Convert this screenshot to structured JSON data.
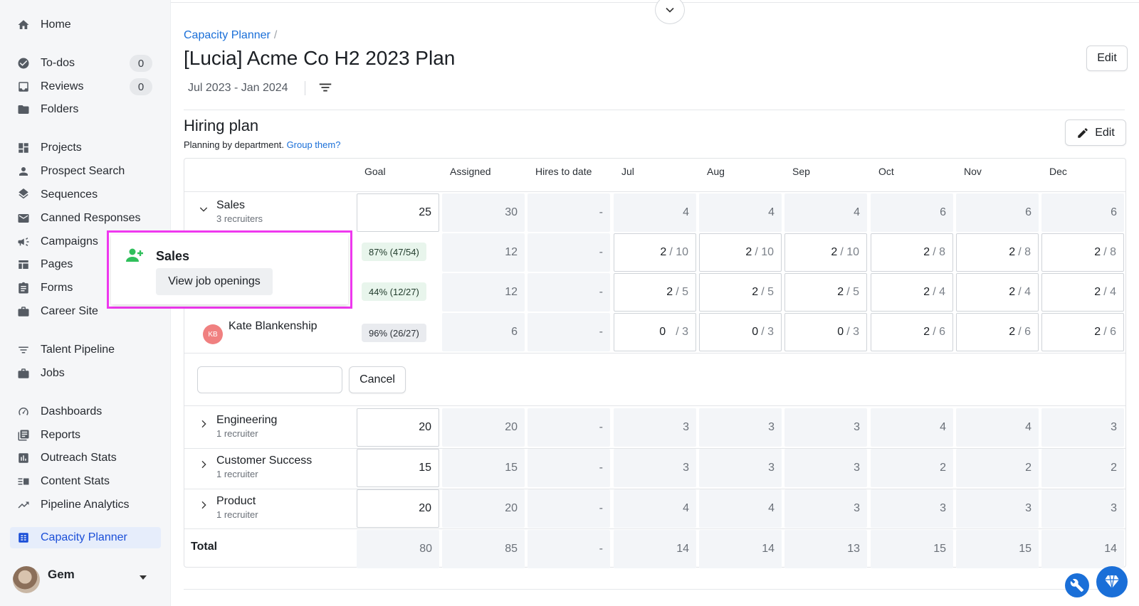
{
  "sidebar": {
    "items": [
      {
        "label": "Home",
        "icon": "home-icon"
      },
      {
        "label": "To-dos",
        "icon": "check-circle-icon",
        "count": "0"
      },
      {
        "label": "Reviews",
        "icon": "inbox-icon",
        "count": "0"
      },
      {
        "label": "Folders",
        "icon": "folder-icon"
      },
      {
        "label": "Projects",
        "icon": "dashboard-grid-icon"
      },
      {
        "label": "Prospect Search",
        "icon": "person-icon"
      },
      {
        "label": "Sequences",
        "icon": "layers-icon"
      },
      {
        "label": "Canned Responses",
        "icon": "envelope-icon"
      },
      {
        "label": "Campaigns",
        "icon": "megaphone-icon"
      },
      {
        "label": "Pages",
        "icon": "web-page-icon"
      },
      {
        "label": "Forms",
        "icon": "clipboard-icon"
      },
      {
        "label": "Career Site",
        "icon": "briefcase-icon"
      },
      {
        "label": "Talent Pipeline",
        "icon": "filter-lines-icon"
      },
      {
        "label": "Jobs",
        "icon": "briefcase-icon"
      },
      {
        "label": "Dashboards",
        "icon": "gauge-icon"
      },
      {
        "label": "Reports",
        "icon": "report-icon"
      },
      {
        "label": "Outreach Stats",
        "icon": "bar-chart-icon"
      },
      {
        "label": "Content Stats",
        "icon": "content-stats-icon"
      },
      {
        "label": "Pipeline Analytics",
        "icon": "trend-line-icon"
      },
      {
        "label": "Capacity Planner",
        "icon": "calendar-grid-icon"
      }
    ],
    "user": {
      "name": "Gem"
    }
  },
  "header": {
    "breadcrumb": "Capacity Planner",
    "breadcrumb_sep": "/",
    "title": "[Lucia] Acme Co H2 2023 Plan",
    "edit_label": "Edit",
    "date_range": "Jul 2023 - Jan 2024"
  },
  "section": {
    "title": "Hiring plan",
    "subtitle": "Planning by department.",
    "link": "Group them?",
    "edit_label": "Edit"
  },
  "table": {
    "headers": [
      "Goal",
      "Assigned",
      "Hires to date",
      "Jul",
      "Aug",
      "Sep",
      "Oct",
      "Nov",
      "Dec"
    ],
    "sales": {
      "name": "Sales",
      "sub": "3 recruiters",
      "goal": "25",
      "assigned": "30",
      "hires": "-",
      "months": [
        "4",
        "4",
        "4",
        "6",
        "6",
        "6"
      ]
    },
    "recruiters": [
      {
        "pill": "87% (47/54)",
        "assigned": "12",
        "hires": "-",
        "months": [
          [
            "2",
            "/ 10"
          ],
          [
            "2",
            "/ 10"
          ],
          [
            "2",
            "/ 10"
          ],
          [
            "2",
            "/ 8"
          ],
          [
            "2",
            "/ 8"
          ],
          [
            "2",
            "/ 8"
          ]
        ]
      },
      {
        "pill": "44% (12/27)",
        "assigned": "12",
        "hires": "-",
        "months": [
          [
            "2",
            "/ 5"
          ],
          [
            "2",
            "/ 5"
          ],
          [
            "2",
            "/ 5"
          ],
          [
            "2",
            "/ 4"
          ],
          [
            "2",
            "/ 4"
          ],
          [
            "2",
            "/ 4"
          ]
        ]
      },
      {
        "name": "Kate Blankenship",
        "initials": "KB",
        "pill": "96% (26/27)",
        "assigned": "6",
        "hires": "-",
        "months": [
          [
            "0",
            "/ 3"
          ],
          [
            "0",
            "/ 3"
          ],
          [
            "0",
            "/ 3"
          ],
          [
            "2",
            "/ 6"
          ],
          [
            "2",
            "/ 6"
          ],
          [
            "2",
            "/ 6"
          ]
        ]
      }
    ],
    "cancel_label": "Cancel",
    "departments": [
      {
        "name": "Engineering",
        "sub": "1 recruiter",
        "goal": "20",
        "assigned": "20",
        "hires": "-",
        "months": [
          "3",
          "3",
          "3",
          "4",
          "4",
          "3"
        ]
      },
      {
        "name": "Customer Success",
        "sub": "1 recruiter",
        "goal": "15",
        "assigned": "15",
        "hires": "-",
        "months": [
          "3",
          "3",
          "3",
          "2",
          "2",
          "2"
        ]
      },
      {
        "name": "Product",
        "sub": "1 recruiter",
        "goal": "20",
        "assigned": "20",
        "hires": "-",
        "months": [
          "4",
          "4",
          "3",
          "3",
          "3",
          "3"
        ]
      }
    ],
    "total": {
      "label": "Total",
      "goal": "80",
      "assigned": "85",
      "hires": "-",
      "months": [
        "14",
        "14",
        "13",
        "15",
        "15",
        "14"
      ]
    }
  },
  "popover": {
    "title": "Sales",
    "button": "View job openings"
  },
  "colors": {
    "accent": "#1a6fd8",
    "highlight": "#ef38ef",
    "success": "#2fbf5b"
  }
}
